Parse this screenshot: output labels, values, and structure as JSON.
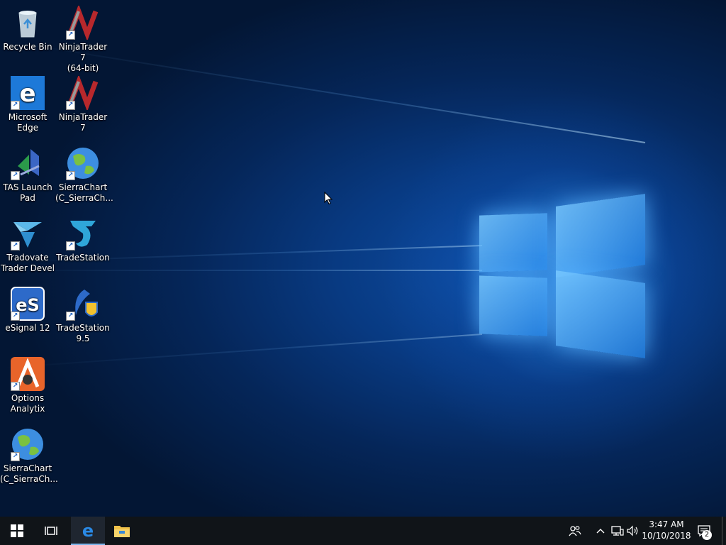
{
  "desktop": {
    "icons": [
      {
        "label": "Recycle Bin",
        "icon": "recycle-bin-icon"
      },
      {
        "label": "NinjaTrader 7\n(64-bit)",
        "icon": "ninjatrader-icon"
      },
      {
        "label": "Microsoft\nEdge",
        "icon": "edge-icon"
      },
      {
        "label": "NinjaTrader 7",
        "icon": "ninjatrader-icon"
      },
      {
        "label": "TAS Launch\nPad",
        "icon": "tas-launchpad-icon"
      },
      {
        "label": "SierraChart\n(C_SierraCh...",
        "icon": "globe-icon"
      },
      {
        "label": "Tradovate\nTrader Devel",
        "icon": "tradovate-icon"
      },
      {
        "label": "TradeStation",
        "icon": "tradestation-icon"
      },
      {
        "label": "eSignal 12",
        "icon": "esignal-icon"
      },
      {
        "label": "TradeStation\n9.5",
        "icon": "tradestation-icon"
      },
      {
        "label": "Options\nAnalytix",
        "icon": "options-analytix-icon"
      },
      {
        "label": "SierraChart\n(C_SierraCh...",
        "icon": "globe-icon"
      }
    ],
    "esignal_text": "eS"
  },
  "taskbar": {
    "clock_time": "3:47 AM",
    "clock_date": "10/10/2018",
    "notification_count": "2"
  }
}
